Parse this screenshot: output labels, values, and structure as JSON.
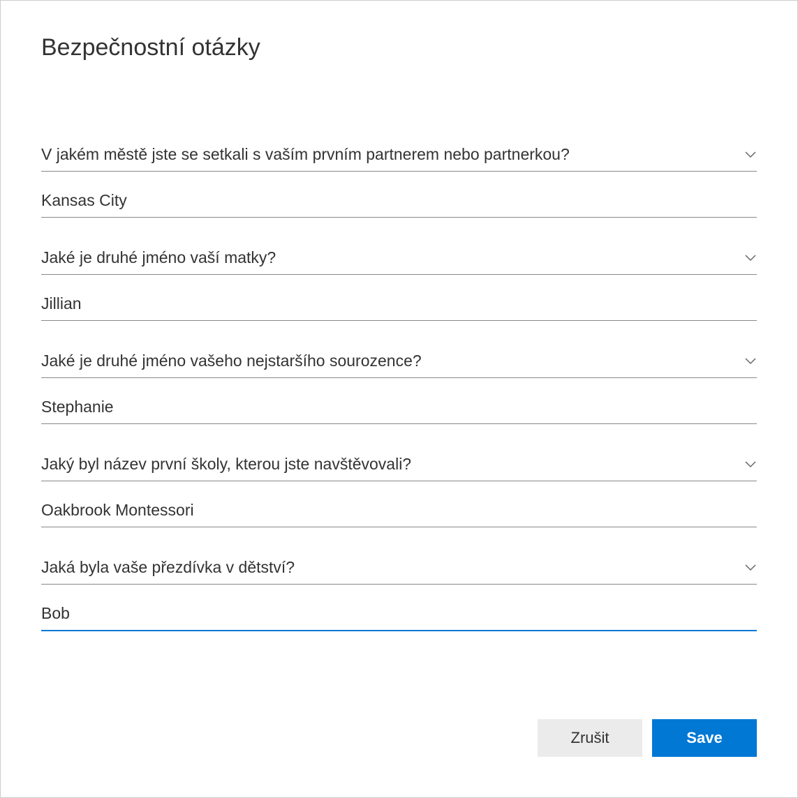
{
  "title": "Bezpečnostní otázky",
  "questions": [
    {
      "question": "V jakém městě jste se setkali s vaším prvním partnerem nebo partnerkou?",
      "answer": "Kansas City",
      "focused": false
    },
    {
      "question": "Jaké je druhé jméno vaší matky?",
      "answer": "Jillian",
      "focused": false
    },
    {
      "question": "Jaké je druhé jméno vašeho nejstaršího sourozence?",
      "answer": "Stephanie",
      "focused": false
    },
    {
      "question": "Jaký byl název první školy, kterou jste navštěvovali?",
      "answer": "Oakbrook Montessori",
      "focused": false
    },
    {
      "question": "Jaká byla vaše přezdívka v dětství?",
      "answer": "Bob",
      "focused": true
    }
  ],
  "buttons": {
    "cancel": "Zrušit",
    "save": "Save"
  }
}
